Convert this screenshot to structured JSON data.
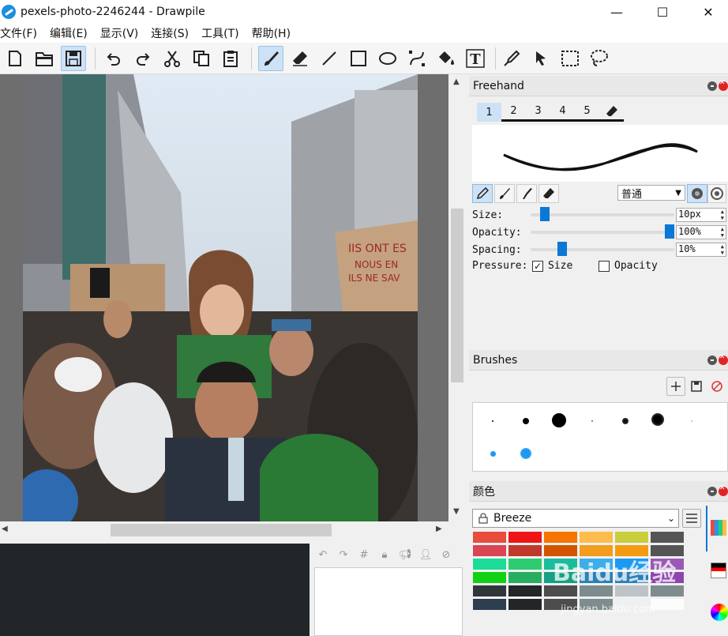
{
  "window": {
    "title": "pexels-photo-2246244 - Drawpile",
    "minimize_icon": "—",
    "maximize_icon": "☐",
    "close_icon": "✕"
  },
  "menu": [
    "文件(F)",
    "编辑(E)",
    "显示(V)",
    "连接(S)",
    "工具(T)",
    "帮助(H)"
  ],
  "toolbar": {
    "icons": [
      "new-file-icon",
      "open-folder-icon",
      "save-icon",
      "undo-icon",
      "redo-icon",
      "cut-icon",
      "copy-icon",
      "paste-icon",
      "freehand-brush-icon",
      "eraser-icon",
      "line-icon",
      "rectangle-icon",
      "ellipse-icon",
      "bezier-icon",
      "fill-bucket-icon",
      "text-tool-icon",
      "color-picker-icon",
      "pointer-icon",
      "rect-select-icon",
      "lasso-select-icon"
    ],
    "text_tool_glyph": "T",
    "active": [
      "save-icon",
      "freehand-brush-icon"
    ]
  },
  "freehand_panel": {
    "title": "Freehand",
    "presets": [
      "1",
      "2",
      "3",
      "4",
      "5"
    ],
    "blend_mode": "普通",
    "size_label": "Size:",
    "size_value": "10px",
    "size_level": 0.07,
    "opacity_label": "Opacity:",
    "opacity_value": "100%",
    "opacity_level": 1.0,
    "spacing_label": "Spacing:",
    "spacing_value": "10%",
    "spacing_level": 0.2,
    "pressure_label": "Pressure:",
    "pressure_size_label": "Size",
    "pressure_size_checked": true,
    "pressure_opacity_label": "Opacity",
    "pressure_opacity_checked": false
  },
  "brushes_panel": {
    "title": "Brushes"
  },
  "color_panel": {
    "title": "颜色",
    "palette_name": "Breeze",
    "swatches": [
      [
        "#e74c3c",
        "#ed1515",
        "#f67400",
        "#fdbc4b",
        "#c9ce3b",
        "#555555"
      ],
      [
        "#da4453",
        "#c0392b",
        "#d35400",
        "#f39c1f",
        "#f39c12",
        "#555555"
      ],
      [
        "#1cdc9a",
        "#2ecc71",
        "#1abc9c",
        "#3daee9",
        "#1d99f3",
        "#9b59b6"
      ],
      [
        "#11d116",
        "#27ae60",
        "#16a085",
        "#2980b9",
        "#2980b9",
        "#8e44ad"
      ],
      [
        "#31363b",
        "#232629",
        "#4d4d4d",
        "#7f8c8d",
        "#bdc3c7",
        "#7f8c8d"
      ],
      [
        "#2c3e50",
        "#232629",
        "#4d4d4d",
        "#7f8c8d",
        "#eff0f1",
        "#fcfcfc"
      ]
    ]
  },
  "watermark": {
    "text": "Baidu经验",
    "url_text": "jingyan.baidu.com"
  }
}
